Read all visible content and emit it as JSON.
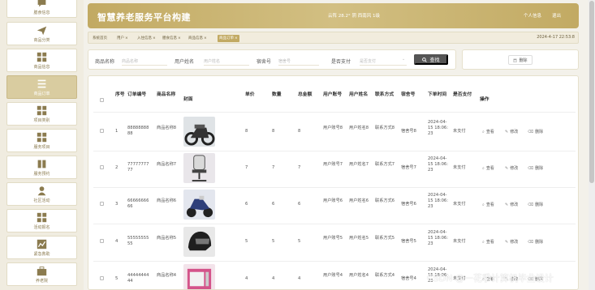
{
  "header": {
    "title": "智慧养老服务平台构建",
    "weather": "云阵 28.2° 阴 西南风 1级",
    "user_label": "个人信息",
    "logout_label": "退出"
  },
  "sidebar": {
    "items": [
      {
        "label": "膳食信息",
        "icon": "chat-icon"
      },
      {
        "label": "商品分类",
        "icon": "send-icon"
      },
      {
        "label": "商品信息",
        "icon": "grid-icon"
      },
      {
        "label": "商品订单",
        "icon": "list-icon",
        "active": true
      },
      {
        "label": "项目类别",
        "icon": "grid-icon"
      },
      {
        "label": "服务项目",
        "icon": "grid-icon"
      },
      {
        "label": "服务预约",
        "icon": "book-icon"
      },
      {
        "label": "社区活动",
        "icon": "user-icon"
      },
      {
        "label": "活动报名",
        "icon": "grid-icon"
      },
      {
        "label": "紧急救助",
        "icon": "chart-icon"
      },
      {
        "label": "养老院",
        "icon": "briefcase-icon"
      }
    ]
  },
  "tabs": [
    {
      "label": "系统首页",
      "closable": false
    },
    {
      "label": "用户",
      "closable": true
    },
    {
      "label": "入住信息",
      "closable": true
    },
    {
      "label": "膳食信息",
      "closable": true
    },
    {
      "label": "商品信息",
      "closable": true
    },
    {
      "label": "商品订单",
      "closable": true,
      "active": true
    }
  ],
  "datetime": "2024-4-17 22:53:8",
  "search": {
    "fields": [
      {
        "label": "商品名称",
        "placeholder": "商品名称"
      },
      {
        "label": "用户姓名",
        "placeholder": "用户姓名"
      },
      {
        "label": "宿舍号",
        "placeholder": "宿舍号"
      },
      {
        "label": "是否支付",
        "placeholder": "是否支付"
      }
    ],
    "button_label": "查找"
  },
  "delete_label": "删除",
  "table": {
    "columns": [
      "序号",
      "订单编号",
      "商品名称",
      "封面",
      "单价",
      "数量",
      "总金额",
      "用户账号",
      "用户姓名",
      "联系方式",
      "宿舍号",
      "下单时间",
      "是否支付",
      "操作"
    ],
    "rows": [
      {
        "seq": "1",
        "order_no": "8888888888",
        "name": "商品名称8",
        "cover": "motorcycle",
        "price": "8",
        "qty": "8",
        "total": "8",
        "account": "用户账号8",
        "username": "用户姓名8",
        "contact": "联系方式8",
        "dorm": "宿舍号8",
        "time": "2024-04-15 18:06:23",
        "paid": "未支付"
      },
      {
        "seq": "2",
        "order_no": "7777777777",
        "name": "商品名称7",
        "cover": "chair",
        "price": "7",
        "qty": "7",
        "total": "7",
        "account": "用户账号7",
        "username": "用户姓名7",
        "contact": "联系方式7",
        "dorm": "宿舍号7",
        "time": "2024-04-15 18:06:23",
        "paid": "未支付"
      },
      {
        "seq": "3",
        "order_no": "6666666666",
        "name": "商品名称6",
        "cover": "scooter",
        "price": "6",
        "qty": "6",
        "total": "6",
        "account": "用户账号6",
        "username": "用户姓名6",
        "contact": "联系方式6",
        "dorm": "宿舍号6",
        "time": "2024-04-15 18:06:23",
        "paid": "未支付"
      },
      {
        "seq": "4",
        "order_no": "5555555555",
        "name": "商品名称5",
        "cover": "helmet",
        "price": "5",
        "qty": "5",
        "total": "5",
        "account": "用户账号5",
        "username": "用户姓名5",
        "contact": "联系方式5",
        "dorm": "宿舍号5",
        "time": "2024-04-15 18:06:23",
        "paid": "未支付"
      },
      {
        "seq": "5",
        "order_no": "4444444444",
        "name": "商品名称4",
        "cover": "appliance",
        "price": "4",
        "qty": "4",
        "total": "4",
        "account": "用户账号4",
        "username": "用户姓名4",
        "contact": "联系方式4",
        "dorm": "宿舍号4",
        "time": "2024-04-15 18:06:23",
        "paid": "未支付"
      }
    ],
    "actions": {
      "view": "查看",
      "edit": "修改",
      "delete": "删除"
    }
  },
  "watermark": "CSDN @一花季计算机毕业设计",
  "colors": {
    "accent": "#c2aa63",
    "active": "#d9cca0",
    "button": "#555555"
  }
}
